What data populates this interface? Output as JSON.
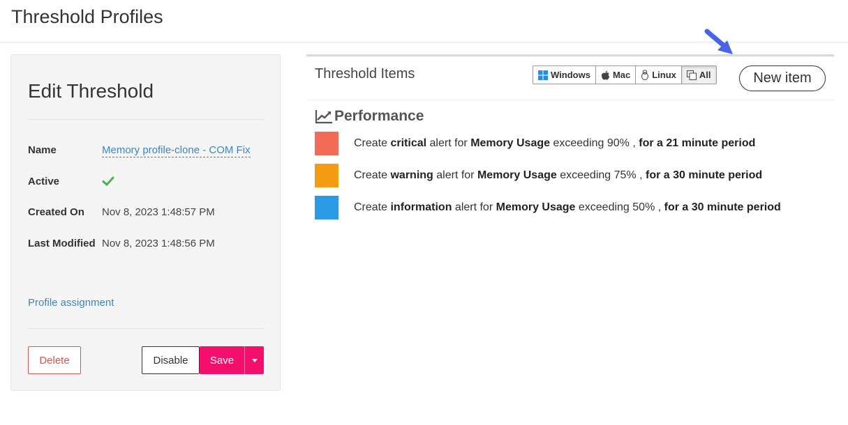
{
  "page": {
    "title": "Threshold Profiles"
  },
  "edit": {
    "title": "Edit Threshold",
    "fields": {
      "name_label": "Name",
      "name_value": "Memory profile-clone - COM Fix",
      "active_label": "Active",
      "created_label": "Created On",
      "created_value": "Nov 8, 2023 1:48:57 PM",
      "modified_label": "Last Modified",
      "modified_value": "Nov 8, 2023 1:48:56 PM"
    },
    "profile_link": "Profile assignment",
    "buttons": {
      "delete": "Delete",
      "disable": "Disable",
      "save": "Save"
    }
  },
  "items": {
    "title": "Threshold Items",
    "os_filters": [
      "Windows",
      "Mac",
      "Linux",
      "All"
    ],
    "new_item": "New item",
    "section": "Performance",
    "rows": [
      {
        "color": "#f26b57",
        "prefix": "Create ",
        "level": "critical",
        "mid": " alert for ",
        "metric": "Memory Usage",
        "cond": " exceeding 90% , ",
        "period": "for a 21 minute period"
      },
      {
        "color": "#f39c12",
        "prefix": "Create ",
        "level": "warning",
        "mid": " alert for ",
        "metric": "Memory Usage",
        "cond": " exceeding 75% , ",
        "period": "for a 30 minute period"
      },
      {
        "color": "#2b9be6",
        "prefix": "Create ",
        "level": "information",
        "mid": " alert for ",
        "metric": "Memory Usage",
        "cond": " exceeding 50% , ",
        "period": "for a 30 minute period"
      }
    ]
  },
  "colors": {
    "accent": "#f50f6c",
    "link": "#3a87c8",
    "success": "#4cae4c",
    "danger": "#d9534f",
    "annotation": "#4a63e8"
  }
}
